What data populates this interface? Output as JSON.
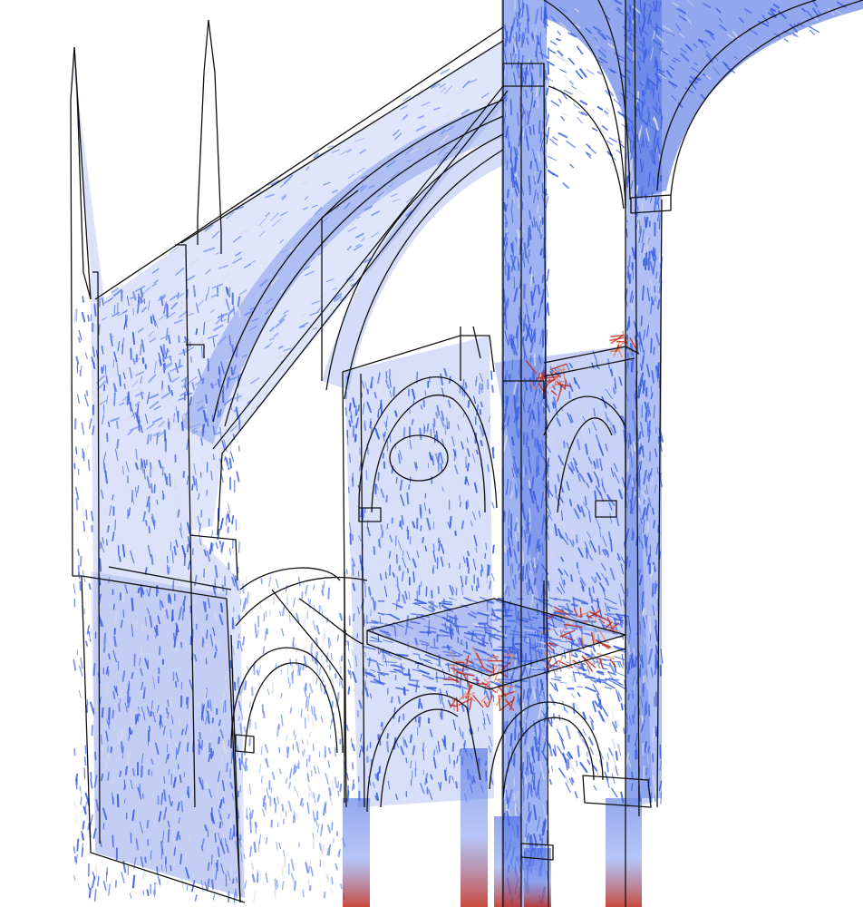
{
  "scene": {
    "subject": "gothic-cathedral-structural-stress-field",
    "colors": {
      "background": "#ffffff",
      "outline": "#111111",
      "low_stress": "#3b5fe0",
      "low_mid_stress": "#6f8ff0",
      "mid_stress": "#d7dbe6",
      "high_mid_stress": "#e08a6a",
      "high_stress": "#c0281b"
    }
  }
}
